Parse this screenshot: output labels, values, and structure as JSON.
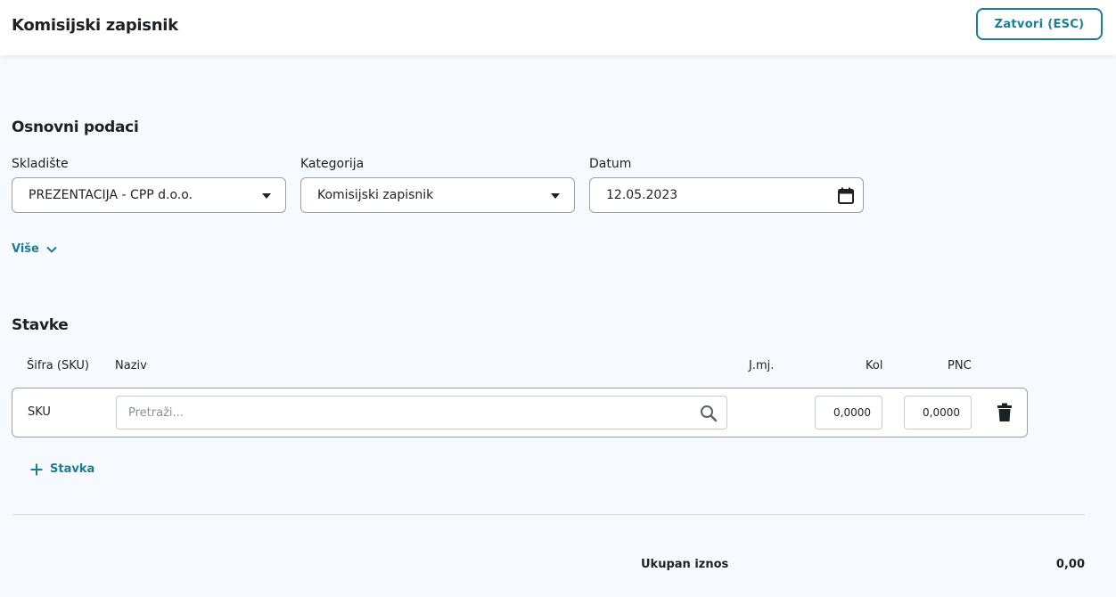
{
  "header": {
    "title": "Komisijski zapisnik",
    "close_label": "Zatvori (ESC)"
  },
  "basic": {
    "title": "Osnovni podaci",
    "warehouse": {
      "label": "Skladište",
      "value": "PREZENTACIJA - CPP d.o.o."
    },
    "category": {
      "label": "Kategorija",
      "value": "Komisijski zapisnik"
    },
    "date": {
      "label": "Datum",
      "value": "12.05.2023"
    },
    "more_label": "Više"
  },
  "items": {
    "title": "Stavke",
    "columns": [
      "Šifra (SKU)",
      "Naziv",
      "J.mj.",
      "Kol",
      "PNC"
    ],
    "row": {
      "sku": "SKU",
      "search_placeholder": "Pretraži...",
      "qty": "0,0000",
      "pnc": "0,0000"
    },
    "add_label": "Stavka"
  },
  "total": {
    "label": "Ukupan iznos",
    "value": "0,00"
  },
  "colors": {
    "accent": "#1a7f96",
    "background": "#f6f9fd",
    "border": "#9aa1a8"
  },
  "icons": [
    "chevron-down-icon",
    "calendar-icon",
    "search-icon",
    "trash-icon",
    "plus-icon",
    "caret-down-icon"
  ]
}
